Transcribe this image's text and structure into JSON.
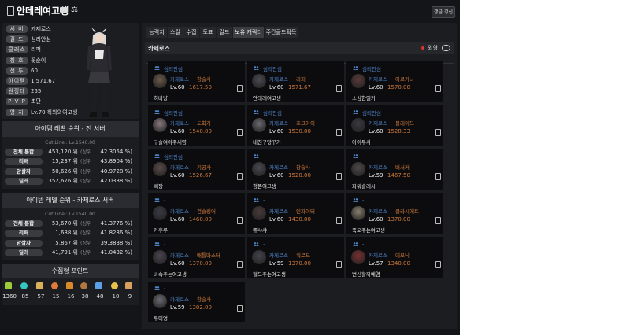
{
  "header": {
    "title": "안데레여고생",
    "refresh_label": "갱글 갱신"
  },
  "profile": {
    "rows": [
      {
        "label": "서 버",
        "value": "카제로스"
      },
      {
        "label": "길 드",
        "value": "심리안심"
      },
      {
        "label": "클래스",
        "value": "리퍼"
      },
      {
        "label": "칭 호",
        "value": "꽃순이"
      },
      {
        "label": "전 투",
        "value": "60"
      },
      {
        "label": "아이템",
        "value": "1,571.67"
      },
      {
        "label": "원정대",
        "value": "255"
      },
      {
        "label": "P V P",
        "value": "초단"
      },
      {
        "label": "영 지",
        "value": "Lv.70 하와와여고생"
      }
    ]
  },
  "rank_all": {
    "title": "아이템 레벨 순위 - 전 서버",
    "cutline": "Cut Line : Lv.1540.00",
    "rows": [
      {
        "label": "전체 통합",
        "num": "453,120 위",
        "sub": "(상위",
        "pct": "42.3054 %)"
      },
      {
        "label": "리퍼",
        "num": "15,237 위",
        "sub": "(상위",
        "pct": "43.8904 %)"
      },
      {
        "label": "암살자",
        "num": "50,626 위",
        "sub": "(상위",
        "pct": "40.9728 %)"
      },
      {
        "label": "딜러",
        "num": "352,676 위",
        "sub": "(상위",
        "pct": "42.0338 %)"
      }
    ]
  },
  "rank_server": {
    "title": "아이템 레벨 순위 - 카제로스 서버",
    "cutline": "Cut Line : Lv.1540.00",
    "rows": [
      {
        "label": "전체 통합",
        "num": "53,670 위",
        "sub": "(상위",
        "pct": "41.3776 %)"
      },
      {
        "label": "리퍼",
        "num": "1,688 위",
        "sub": "(상위",
        "pct": "41.8236 %)"
      },
      {
        "label": "암살자",
        "num": "5,867 위",
        "sub": "(상위",
        "pct": "39.3838 %)"
      },
      {
        "label": "딜러",
        "num": "41,791 위",
        "sub": "(상위",
        "pct": "41.0432 %)"
      }
    ]
  },
  "collection": {
    "title": "수집형 포인트",
    "items": [
      {
        "icon": "mokoko-seed-icon",
        "value": "1360",
        "color": "#9ccc3a"
      },
      {
        "icon": "island-heart-icon",
        "value": "85",
        "color": "#35c6c0"
      },
      {
        "icon": "masterpiece-icon",
        "value": "57",
        "color": "#d9b15a"
      },
      {
        "icon": "giant-heart-icon",
        "value": "15",
        "color": "#e07a3a"
      },
      {
        "icon": "ignea-token-icon",
        "value": "16",
        "color": "#d88a2a"
      },
      {
        "icon": "sea-bounty-icon",
        "value": "38",
        "color": "#b07840"
      },
      {
        "icon": "world-tree-leaf-icon",
        "value": "48",
        "color": "#5aa0e8"
      },
      {
        "icon": "orpheus-star-icon",
        "value": "10",
        "color": "#e8c050"
      },
      {
        "icon": "omnium-star-icon",
        "value": "9",
        "color": "#d8a060"
      }
    ]
  },
  "tabs": [
    "능력치",
    "스킬",
    "수집",
    "도표",
    "길드",
    "보유 캐릭터",
    "주간골드획득"
  ],
  "active_tab": "보유 캐릭터",
  "characters_header": {
    "server": "카제로스",
    "toggle_label": "외형"
  },
  "characters": [
    {
      "guild": "심리안심",
      "server": "카제로스",
      "cls": "창술사",
      "lv": "Lv.60",
      "ilvl": "1617.50",
      "name": "히바냥",
      "avatar": "#6a5a4a"
    },
    {
      "guild": "심리안심",
      "server": "카제로스",
      "cls": "리퍼",
      "lv": "Lv.60",
      "ilvl": "1571.67",
      "name": "안데레여고생",
      "avatar": "#4a4a52"
    },
    {
      "guild": "심리안심",
      "server": "카제로스",
      "cls": "아르카나",
      "lv": "Lv.60",
      "ilvl": "1570.00",
      "name": "소심한일카",
      "avatar": "#5a3a3a"
    },
    {
      "guild": "심리안심",
      "server": "카제로스",
      "cls": "도화가",
      "lv": "Lv.60",
      "ilvl": "1540.00",
      "name": "구슬여아주세영",
      "avatar": "#8a7a80"
    },
    {
      "guild": "심리안심",
      "server": "카제로스",
      "cls": "호크아이",
      "lv": "Lv.60",
      "ilvl": "1530.00",
      "name": "내친구망꾸기",
      "avatar": "#6a6a70"
    },
    {
      "guild": "심리안심",
      "server": "카제로스",
      "cls": "블레이드",
      "lv": "Lv.60",
      "ilvl": "1528.33",
      "name": "아이투사",
      "avatar": "#3a3a40"
    },
    {
      "guild": "심리안심",
      "server": "카제로스",
      "cls": "기공사",
      "lv": "Lv.60",
      "ilvl": "1526.67",
      "name": "빼짱",
      "avatar": "#5a4a48"
    },
    {
      "guild": "-",
      "server": "카제로스",
      "cls": "창술사",
      "lv": "Lv.60",
      "ilvl": "1520.00",
      "name": "청뜬여고생",
      "avatar": "#4a4a50"
    },
    {
      "guild": "-",
      "server": "카제로스",
      "cls": "버서커",
      "lv": "Lv.59",
      "ilvl": "1467.50",
      "name": "파워슬레시",
      "avatar": "#504848"
    },
    {
      "guild": "-",
      "server": "카제로스",
      "cls": "건슬링어",
      "lv": "Lv.60",
      "ilvl": "1460.00",
      "name": "카후루",
      "avatar": "#3a3a44"
    },
    {
      "guild": "-",
      "server": "카제로스",
      "cls": "인파이터",
      "lv": "Lv.60",
      "ilvl": "1430.00",
      "name": "쀼샤샤",
      "avatar": "#4a3a3a"
    },
    {
      "guild": "-",
      "server": "카제로스",
      "cls": "클라시에트",
      "lv": "Lv.60",
      "ilvl": "1370.00",
      "name": "죽오주는여고생",
      "avatar": "#8a8070"
    },
    {
      "guild": "-",
      "server": "카제로스",
      "cls": "배틀마스터",
      "lv": "Lv.60",
      "ilvl": "1370.00",
      "name": "바속주는여고생",
      "avatar": "#4a4450"
    },
    {
      "guild": "-",
      "server": "카제로스",
      "cls": "워로드",
      "lv": "Lv.59",
      "ilvl": "1370.00",
      "name": "혈드주는여고생",
      "avatar": "#44444a"
    },
    {
      "guild": "-",
      "server": "카제로스",
      "cls": "데모닉",
      "lv": "Lv.57",
      "ilvl": "1340.00",
      "name": "변신할까예염",
      "avatar": "#7a3030"
    },
    {
      "guild": "-",
      "server": "카제로스",
      "cls": "창술사",
      "lv": "Lv.59",
      "ilvl": "1302.00",
      "name": "루미엉",
      "avatar": "#6a6a72"
    }
  ]
}
